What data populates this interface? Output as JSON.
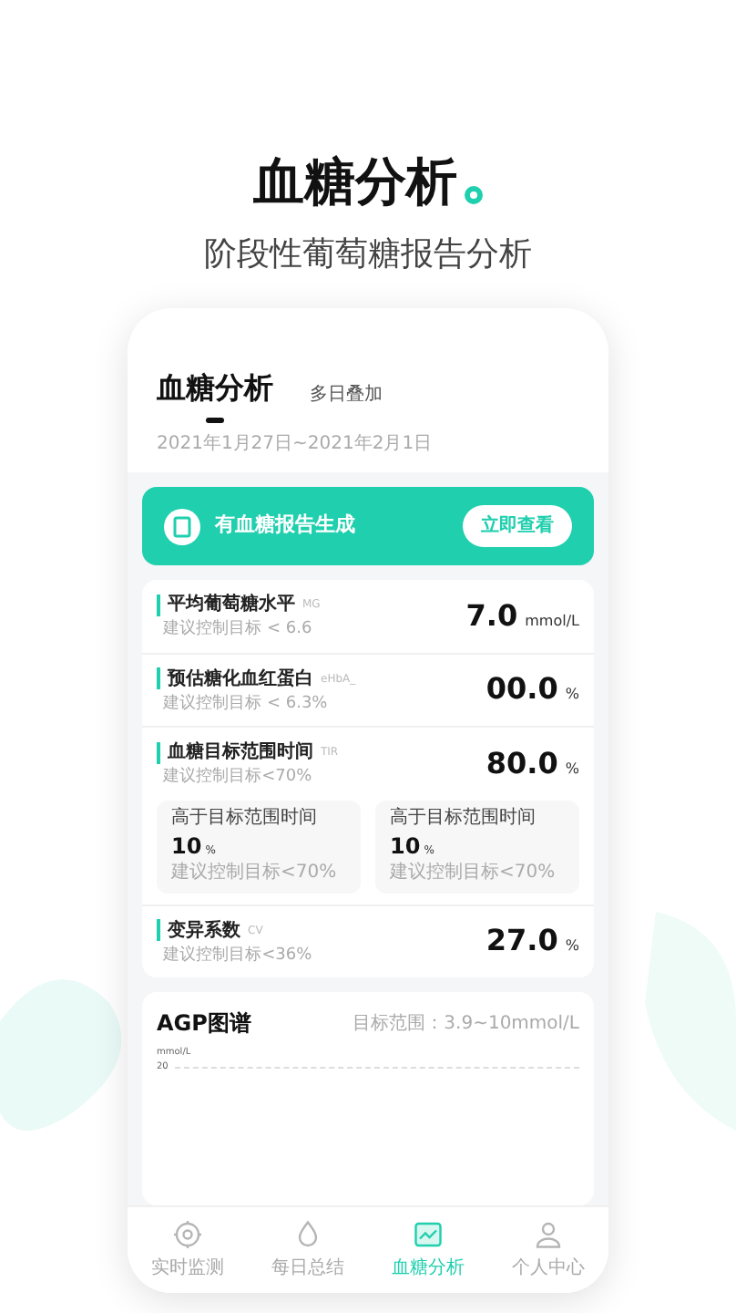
{
  "headline": {
    "title": "血糖分析",
    "subtitle": "阶段性葡萄糖报告分析"
  },
  "tabs": [
    {
      "label": "血糖分析",
      "selected": true
    },
    {
      "label": "多日叠加",
      "selected": false
    }
  ],
  "date_range": "2021年1月27日~2021年2月1日",
  "banner": {
    "text": "有血糖报告生成",
    "button": "立即查看"
  },
  "metrics": [
    {
      "kind": "simple",
      "name": "平均葡萄糖水平",
      "abbr": "MG",
      "target": "建议控制目标 < 6.6",
      "value": "7.0",
      "unit": "mmol/L"
    },
    {
      "kind": "simple",
      "name": "预估糖化血红蛋白",
      "abbr": "eHbA_",
      "target": "建议控制目标 < 6.3%",
      "value": "00.0",
      "unit": "%"
    },
    {
      "kind": "split",
      "name": "血糖目标范围时间",
      "abbr": "TIR",
      "target": "建议控制目标<70%",
      "value": "80.0",
      "unit": "%",
      "parts": [
        {
          "label": "高于目标范围时间",
          "value": "10",
          "unit": "%",
          "target": "建议控制目标<70%"
        },
        {
          "label": "高于目标范围时间",
          "value": "10",
          "unit": "%",
          "target": "建议控制目标<70%"
        }
      ]
    },
    {
      "kind": "simple",
      "name": "变异系数",
      "abbr": "CV",
      "target": "建议控制目标<36%",
      "value": "27.0",
      "unit": "%"
    }
  ],
  "agp": {
    "title": "AGP图谱",
    "range": "目标范围：3.9~10mmol/L",
    "y_unit": "mmol/L",
    "y_tick": "20"
  },
  "nav": [
    {
      "label": "实时监测",
      "selected": false
    },
    {
      "label": "每日总结",
      "selected": false
    },
    {
      "label": "血糖分析",
      "selected": true
    },
    {
      "label": "个人中心",
      "selected": false
    }
  ]
}
